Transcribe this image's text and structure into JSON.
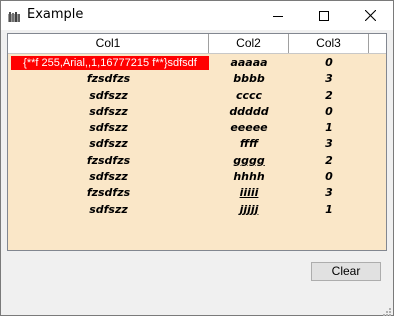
{
  "window": {
    "title": "Example"
  },
  "list": {
    "columns": [
      "Col1",
      "Col2",
      "Col3"
    ],
    "rows": [
      [
        "{**f 255,Arial,,1,16777215 f**}sdfsdf",
        "aaaaa",
        "0"
      ],
      [
        "fzsdfzs",
        "bbbb",
        "3"
      ],
      [
        "sdfszz",
        "cccc",
        "2"
      ],
      [
        "sdfszz",
        "ddddd",
        "0"
      ],
      [
        "sdfszz",
        "eeeee",
        "1"
      ],
      [
        "sdfszz",
        "ffff",
        "3"
      ],
      [
        "fzsdfzs",
        "gggg",
        "2"
      ],
      [
        "sdfszz",
        "hhhh",
        "0"
      ],
      [
        "fzsdfzs",
        "iiiii",
        "3"
      ],
      [
        "sdfszz",
        "jjjjj",
        "1"
      ]
    ]
  },
  "buttons": {
    "clear": "Clear"
  },
  "colors": {
    "list_bg": "#fae7c8",
    "highlight": "#ff0000"
  },
  "icons": {
    "app": "app-icon",
    "minimize": "minimize-icon",
    "maximize": "maximize-icon",
    "close": "close-icon"
  }
}
